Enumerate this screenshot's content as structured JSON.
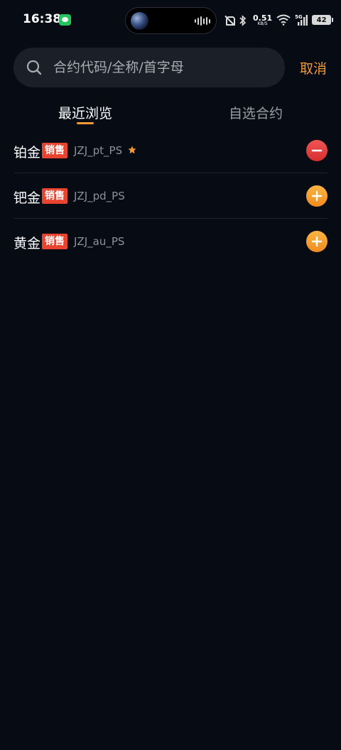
{
  "status_bar": {
    "time": "16:38",
    "net_speed_value": "0.51",
    "net_speed_unit": "KB/S",
    "signal_label": "5G",
    "battery_level": "42"
  },
  "search": {
    "placeholder": "合约代码/全称/首字母",
    "value": "",
    "cancel_label": "取消"
  },
  "tabs": [
    {
      "label": "最近浏览",
      "active": true
    },
    {
      "label": "自选合约",
      "active": false
    }
  ],
  "contracts": [
    {
      "name": "铂金",
      "badge": "销售",
      "code": "JZJ_pt_PS",
      "starred": true,
      "action": "remove"
    },
    {
      "name": "钯金",
      "badge": "销售",
      "code": "JZJ_pd_PS",
      "starred": false,
      "action": "add"
    },
    {
      "name": "黄金",
      "badge": "销售",
      "code": "JZJ_au_PS",
      "starred": false,
      "action": "add"
    }
  ],
  "colors": {
    "background": "#070b14",
    "accent": "#f59a33",
    "badge": "#e8442f",
    "remove": "#e23b3b",
    "add": "#f7a233"
  }
}
